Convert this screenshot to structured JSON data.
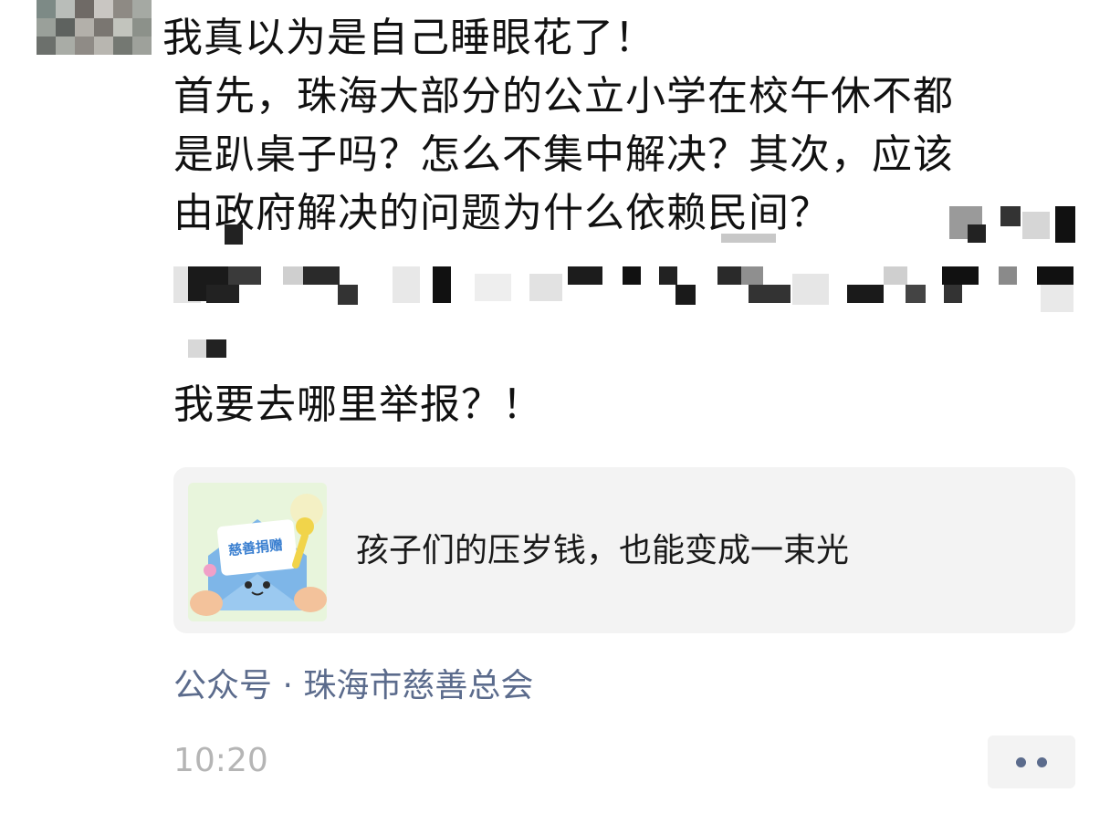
{
  "post": {
    "lines": [
      "我真以为是自己睡眼花了！",
      "首先，珠海大部分的公立小学在校午休不都",
      "是趴桌子吗？怎么不集中解决？其次，应该",
      "由政府解决的问题为什么依赖民间？"
    ],
    "last_line": "我要去哪里举报？！"
  },
  "shared_card": {
    "title": "孩子们的压岁钱，也能变成一束光",
    "thumbnail_label": "慈善捐赠"
  },
  "source": "公众号 · 珠海市慈善总会",
  "timestamp": "10:20",
  "colors": {
    "link": "#5b6b8c",
    "time": "#b5b5b5",
    "card_bg": "#f3f3f3"
  }
}
